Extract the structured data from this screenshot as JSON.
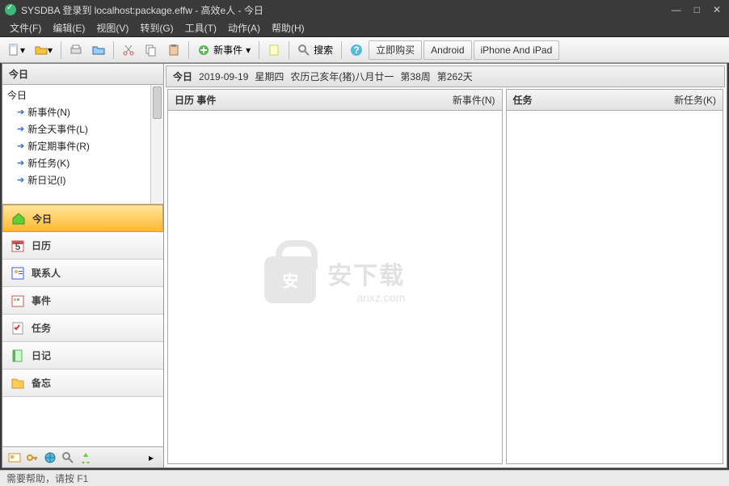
{
  "title": "SYSDBA 登录到 localhost:package.effw - 高效e人 - 今日",
  "menu": {
    "file": "文件(F)",
    "edit": "编辑(E)",
    "view": "视图(V)",
    "goto": "转到(G)",
    "tools": "工具(T)",
    "action": "动作(A)",
    "help": "帮助(H)"
  },
  "toolbar": {
    "new_event": "新事件",
    "search": "搜索",
    "buy_now": "立即购买",
    "android": "Android",
    "iphone": "iPhone And iPad"
  },
  "sidebar": {
    "header": "今日",
    "tree_root": "今日",
    "items": [
      {
        "label": "新事件(N)"
      },
      {
        "label": "新全天事件(L)"
      },
      {
        "label": "新定期事件(R)"
      },
      {
        "label": "新任务(K)"
      },
      {
        "label": "新日记(I)"
      }
    ],
    "nav": [
      {
        "label": "今日",
        "key": "today"
      },
      {
        "label": "日历",
        "key": "calendar"
      },
      {
        "label": "联系人",
        "key": "contacts"
      },
      {
        "label": "事件",
        "key": "events"
      },
      {
        "label": "任务",
        "key": "tasks"
      },
      {
        "label": "日记",
        "key": "diary"
      },
      {
        "label": "备忘",
        "key": "memo"
      }
    ]
  },
  "datebar": {
    "label": "今日",
    "date": "2019-09-19",
    "weekday": "星期四",
    "lunar": "农历己亥年(猪)八月廿一",
    "week": "第38周",
    "day": "第262天"
  },
  "panels": {
    "calendar": {
      "title": "日历  事件",
      "action": "新事件(N)"
    },
    "tasks": {
      "title": "任务",
      "action": "新任务(K)"
    }
  },
  "watermark": {
    "big": "安下载",
    "small": "anxz.com"
  },
  "status": "需要帮助，请按 F1"
}
